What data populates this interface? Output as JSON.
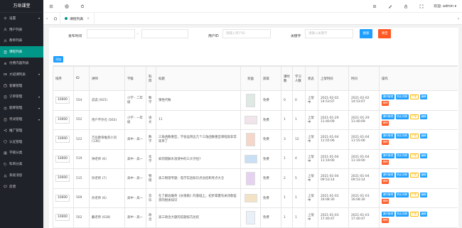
{
  "brand": "万岳课堂",
  "sidebar": {
    "items": [
      {
        "label": "设置",
        "icon": "gear-icon",
        "arrow": "▾",
        "active": false
      },
      {
        "label": "用户列表",
        "icon": "user-icon",
        "arrow": "",
        "active": false
      },
      {
        "label": "教师列表",
        "icon": "user-icon",
        "arrow": "",
        "active": false
      },
      {
        "label": "课程列表",
        "icon": "book-icon",
        "arrow": "",
        "active": true
      },
      {
        "label": "付费内容列表",
        "icon": "list-icon",
        "arrow": "",
        "active": false
      },
      {
        "label": "大班课列表",
        "icon": "video-icon",
        "arrow": "▾",
        "active": false
      },
      {
        "label": "套餐管理",
        "icon": "package-icon",
        "arrow": "",
        "active": false
      },
      {
        "label": "订单管理",
        "icon": "order-icon",
        "arrow": "▾",
        "active": false
      },
      {
        "label": "题库管理",
        "icon": "question-icon",
        "arrow": "▾",
        "active": false
      },
      {
        "label": "考试管理",
        "icon": "exam-icon",
        "arrow": "▾",
        "active": false
      },
      {
        "label": "推广管理",
        "icon": "share-icon",
        "arrow": "",
        "active": false
      },
      {
        "label": "认证管理",
        "icon": "shield-icon",
        "arrow": "",
        "active": false
      },
      {
        "label": "学级分类",
        "icon": "grid-icon",
        "arrow": "",
        "active": false
      },
      {
        "label": "科目分类",
        "icon": "tag-icon",
        "arrow": "",
        "active": false
      },
      {
        "label": "系统消息",
        "icon": "bell-icon",
        "arrow": "",
        "active": false
      },
      {
        "label": "反馈",
        "icon": "chat-icon",
        "arrow": "",
        "active": false
      }
    ]
  },
  "header": {
    "user": "欢迎: admin ▾"
  },
  "tabs": {
    "active_label": "课程列表",
    "close": "×"
  },
  "filter": {
    "time_label": "发布时间",
    "sep": "-",
    "uid_label": "用户ID",
    "uid_placeholder": "请输入用户ID",
    "keyword_label": "关键字",
    "keyword_placeholder": "请输入关键字",
    "search": "搜索",
    "clear": "清空"
  },
  "add_label": "添加",
  "table": {
    "columns": [
      "排序",
      "ID",
      "讲师",
      "学级",
      "科目",
      "标题",
      "封面",
      "获取",
      "课时数",
      "学习人数",
      "状态",
      "上架时间",
      "时间",
      "操作"
    ],
    "rows": [
      {
        "sort": "10000",
        "id": "554",
        "teacher": "说说 (925)",
        "grade": "小学 - 二年级",
        "subject": "数学",
        "title": "猜性代数",
        "get": "免费",
        "lessons": "0",
        "learners": "0",
        "status": "上架中",
        "up": "2021-02-02 14:53:07",
        "time": "2021-02-02 14:53:07",
        "cover_color": "#dfe9e3"
      },
      {
        "sort": "10000",
        "id": "552",
        "teacher": "用户不存在 (563)",
        "grade": "小学 - 一年级",
        "subject": "语文",
        "title": "11",
        "get": "免费",
        "lessons": "1",
        "learners": "1",
        "status": "上架中",
        "up": "2021-01-29 11:40:09",
        "time": "2021-01-29 11:40:09",
        "cover_color": "#f1e4ea"
      },
      {
        "sort": "10000",
        "id": "522",
        "teacher": "万岳教育推荐小刘 (136)",
        "grade": "高中 - 高一",
        "subject": "数学",
        "title": "三角函数重型，学会运用这几个三角函数重型课程就非常简单了",
        "get": "免费",
        "lessons": "3",
        "learners": "12",
        "status": "上架中",
        "up": "2021-01-04 11:55:06",
        "time": "2021-01-04 11:55:06",
        "cover_color": "#f5d6c9"
      },
      {
        "sort": "10000",
        "id": "519",
        "teacher": "钟老师 (6)",
        "grade": "高中 - 高一",
        "subject": "化学",
        "title": "如何理解水溶液中的三大守恒?",
        "get": "免费",
        "lessons": "1",
        "learners": "4",
        "status": "上架中",
        "up": "2021-01-04 11:19:00",
        "time": "2021-01-04 11:19:00",
        "cover_color": "#c8dff5"
      },
      {
        "sort": "10000",
        "id": "515",
        "teacher": "孙老师 (7)",
        "grade": "高中 - 高一",
        "subject": "物理",
        "title": "高三物理专题：电学实验知识点总结和考点大全",
        "get": "免费",
        "lessons": "2",
        "learners": "5",
        "status": "上架中",
        "up": "2021-01-04 09:53:14",
        "time": "2021-01-04 09:53:14",
        "cover_color": "#e6d2f0"
      },
      {
        "sort": "10000",
        "id": "509",
        "teacher": "孙老师 (6)",
        "grade": "高中 - 高一",
        "subject": "音乐",
        "title": "在了解准确英《长恨歌》的基础上，初步掌握有关诗歌鉴赏的相关知识",
        "get": "免费",
        "lessons": "1",
        "learners": "1",
        "status": "上架中",
        "up": "2021-01-03 16:08:30",
        "time": "2021-01-03 16:08:30",
        "cover_color": "#f3e3c4"
      },
      {
        "sort": "10000",
        "id": "502",
        "teacher": "戴老师 (028)",
        "grade": "高中 - 高一",
        "subject": "政治",
        "title": "高三政治大题的答题技巧总结",
        "get": "免费",
        "lessons": "1",
        "learners": "1",
        "status": "上架中",
        "up": "2021-01-03 17:40:47",
        "time": "2021-01-03 17:40:47",
        "cover_color": "#e9f0f8"
      }
    ],
    "ops": {
      "edit_lessons": "课时管理",
      "buy_detail": "购买详情",
      "offline": "下架",
      "edit": "编辑",
      "delete": "删除"
    }
  }
}
